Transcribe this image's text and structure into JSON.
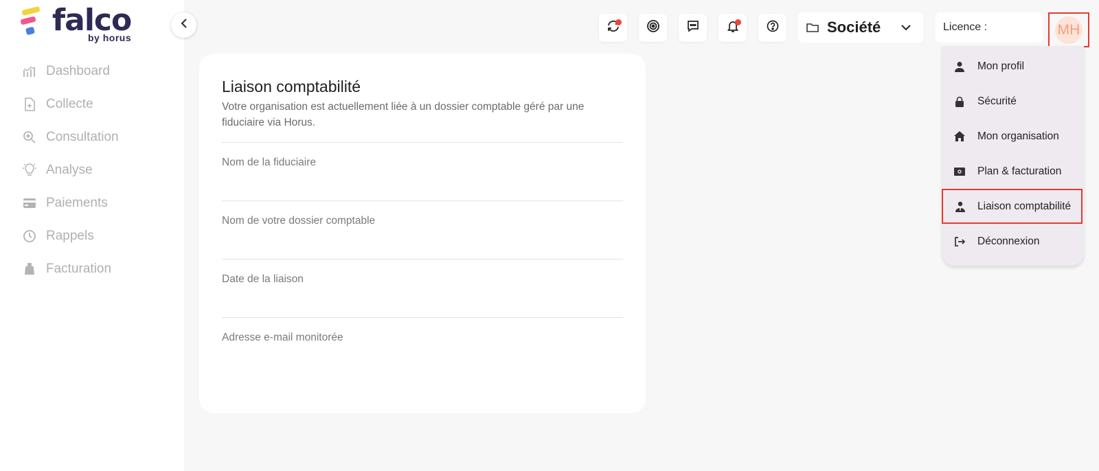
{
  "brand": {
    "name": "falco",
    "tagline": "by horus"
  },
  "sidebar": {
    "items": [
      {
        "label": "Dashboard",
        "icon": "chart-icon"
      },
      {
        "label": "Collecte",
        "icon": "file-add-icon"
      },
      {
        "label": "Consultation",
        "icon": "zoom-icon"
      },
      {
        "label": "Analyse",
        "icon": "bulb-icon"
      },
      {
        "label": "Paiements",
        "icon": "card-icon"
      },
      {
        "label": "Rappels",
        "icon": "clock-icon"
      },
      {
        "label": "Facturation",
        "icon": "bag-icon"
      }
    ]
  },
  "topbar": {
    "company_label": "Société",
    "licence_label": "Licence :",
    "avatar_initials": "MH"
  },
  "card": {
    "title": "Liaison comptabilité",
    "description": "Votre organisation est actuellement liée à un dossier comptable géré par une fiduciaire via Horus.",
    "fields": [
      {
        "label": "Nom de la fiduciaire",
        "value": ""
      },
      {
        "label": "Nom de votre dossier comptable",
        "value": ""
      },
      {
        "label": "Date de la liaison",
        "value": ""
      },
      {
        "label": "Adresse e-mail monitorée",
        "value": ""
      }
    ]
  },
  "user_menu": {
    "items": [
      {
        "label": "Mon profil",
        "icon": "user-icon"
      },
      {
        "label": "Sécurité",
        "icon": "lock-icon"
      },
      {
        "label": "Mon organisation",
        "icon": "home-icon"
      },
      {
        "label": "Plan & facturation",
        "icon": "money-icon"
      },
      {
        "label": "Liaison comptabilité",
        "icon": "accountant-icon"
      },
      {
        "label": "Déconnexion",
        "icon": "logout-icon"
      }
    ]
  },
  "colors": {
    "brand_navy": "#2d2a55",
    "highlight_red": "#e53a30",
    "notification_dot": "#f0443a",
    "avatar_bg": "#fde3d8"
  }
}
